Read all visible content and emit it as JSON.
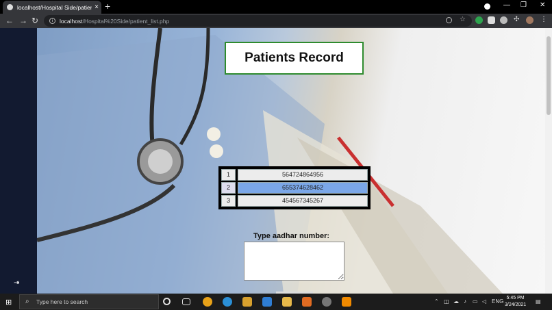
{
  "browser": {
    "tab_title": "localhost/Hospital Side/patient_l",
    "tab_close": "×",
    "new_tab": "+",
    "url_host": "localhost",
    "url_path": "/Hospital%20Side/patient_list.php",
    "back": "←",
    "forward": "→",
    "reload": "↻"
  },
  "window_controls": {
    "minimize": "—",
    "maximize": "❐",
    "close": "✕"
  },
  "page": {
    "title": "Patients Record",
    "records": [
      {
        "index": "1",
        "value": "564724864956"
      },
      {
        "index": "2",
        "value": "655374628462"
      },
      {
        "index": "3",
        "value": "454567345267"
      }
    ],
    "selected_index": "2",
    "input_label": "Type aadhar number:",
    "input_value": ""
  },
  "taskbar": {
    "search_placeholder": "Type here to search",
    "language": "ENG",
    "time": "5:45 PM",
    "date": "3/24/2021"
  },
  "colors": {
    "accent_border": "#2e8b2e",
    "selected_row": "#7aa7e8",
    "sidebar": "#121a30"
  }
}
